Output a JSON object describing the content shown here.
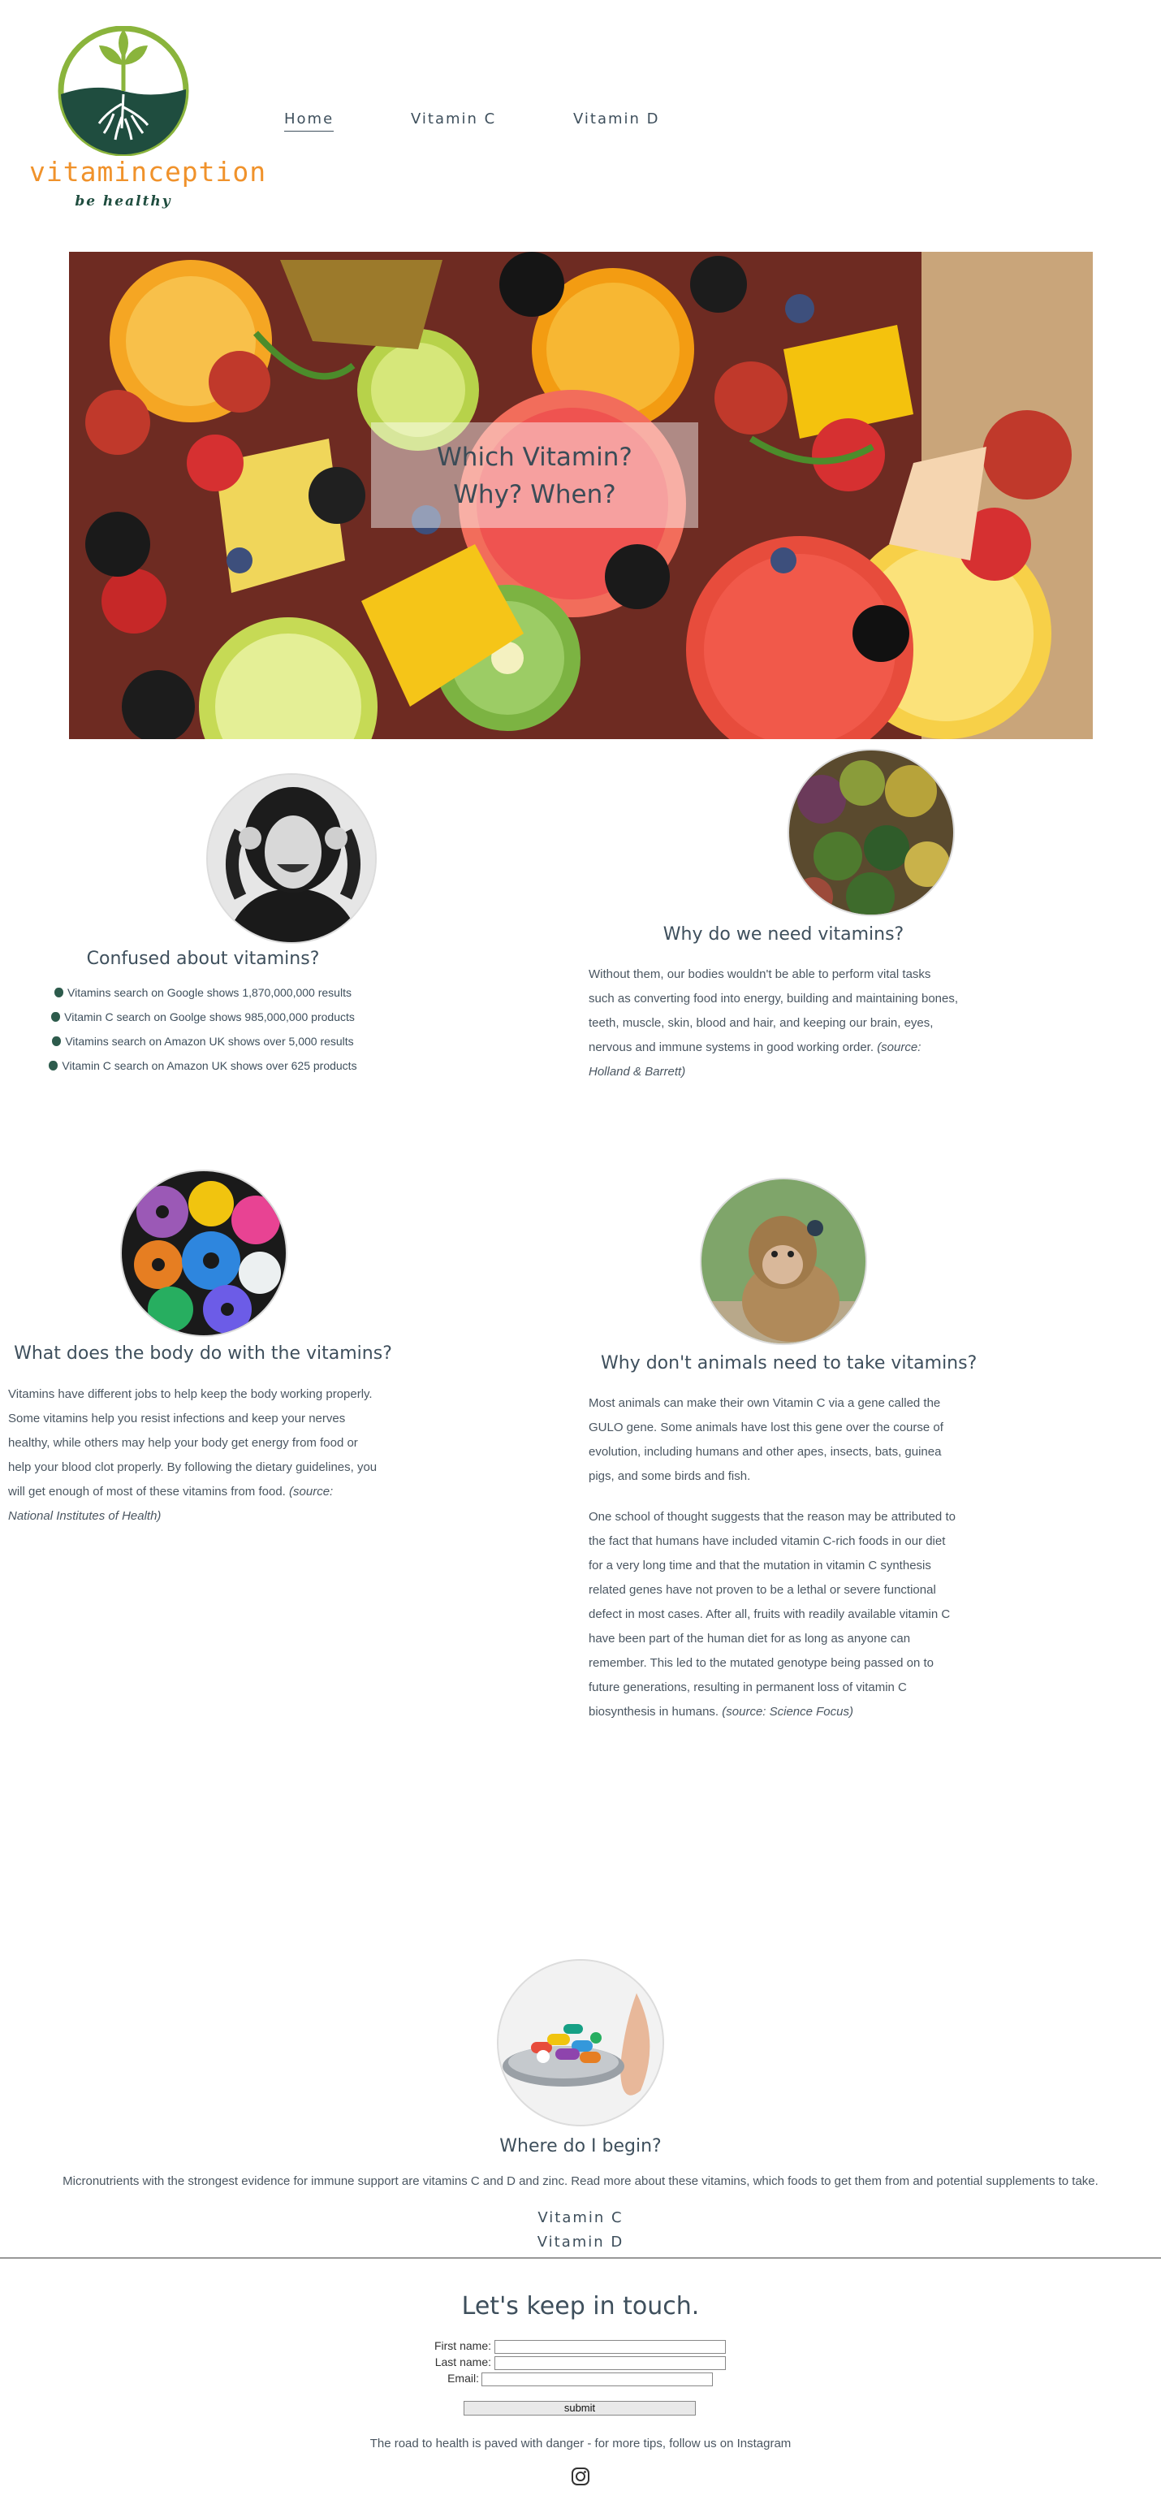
{
  "brand": {
    "name": "vitaminception",
    "tagline": "be healthy"
  },
  "nav": [
    {
      "label": "Home",
      "active": true
    },
    {
      "label": "Vitamin C",
      "active": false
    },
    {
      "label": "Vitamin D",
      "active": false
    }
  ],
  "hero": {
    "line1": "Which Vitamin?",
    "line2": "Why? When?"
  },
  "confused": {
    "title": "Confused about vitamins?",
    "items": [
      "Vitamins search on Google shows 1,870,000,000 results",
      "Vitamin C search on Goolge shows 985,000,000 products",
      "Vitamins search on Amazon UK shows over 5,000 results",
      "Vitamin C search on Amazon UK shows over 625 products"
    ]
  },
  "why": {
    "title": "Why do we need vitamins?",
    "lines": [
      "Without them, our bodies wouldn't be able to perform vital tasks",
      "such as converting food into energy, building and maintaining bones,",
      "teeth, muscle, skin, blood and hair, and keeping our brain, eyes,"
    ],
    "line4": "nervous and immune systems in good working order. ",
    "source_a": "(source:",
    "source_b": "Holland & Barrett)"
  },
  "body": {
    "title": "What does the body do with the vitamins?",
    "lines": [
      "Vitamins have different jobs to help keep the body working properly.",
      "Some vitamins help you resist infections and keep your nerves",
      "healthy, while others may help your body get energy from food or",
      "help your blood clot properly. By following the dietary guidelines, you"
    ],
    "line5": "will get enough of most of these vitamins from food. ",
    "source_a": "(source:",
    "source_b": "National Institutes of Health)"
  },
  "animals": {
    "title": "Why don't animals need to take vitamins?",
    "p1": [
      "Most animals can make their own Vitamin C via a gene called the",
      "GULO gene. Some animals have lost this gene over the course of",
      "evolution, including humans and other apes, insects, bats, guinea",
      "pigs, and some birds and fish."
    ],
    "p2": [
      "One school of thought suggests that the reason may be attributed to",
      "the fact that humans have included vitamin C-rich foods in our diet",
      "for a very long time and that the mutation in vitamin C synthesis",
      "related genes have not proven to be a lethal or severe functional",
      "defect in most cases. After all, fruits with readily available vitamin C",
      "have been part of the human diet for as long as anyone can",
      "remember. This led to the mutated genotype being passed on to",
      "future generations, resulting in permanent loss of vitamin C"
    ],
    "p2_last": "biosynthesis in humans. ",
    "source": "(source: Science Focus)"
  },
  "begin": {
    "title": "Where do I begin?",
    "text": "Micronutrients with the strongest evidence for immune support are vitamins C and D and zinc. Read more about these vitamins, which foods to get them from and potential supplements to take.",
    "link_c": "Vitamin C",
    "link_d": "Vitamin D"
  },
  "contact": {
    "title": "Let's keep in touch.",
    "first_name_label": "First name:",
    "last_name_label": "Last name:",
    "email_label": "Email:",
    "submit_label": "submit",
    "note": "The road to health is paved with danger - for more tips, follow us on Instagram"
  },
  "colors": {
    "logo_green": "#8ab43c",
    "logo_dark": "#1f4d3f",
    "logo_orange": "#f0922b",
    "text": "#3e4f5c"
  }
}
